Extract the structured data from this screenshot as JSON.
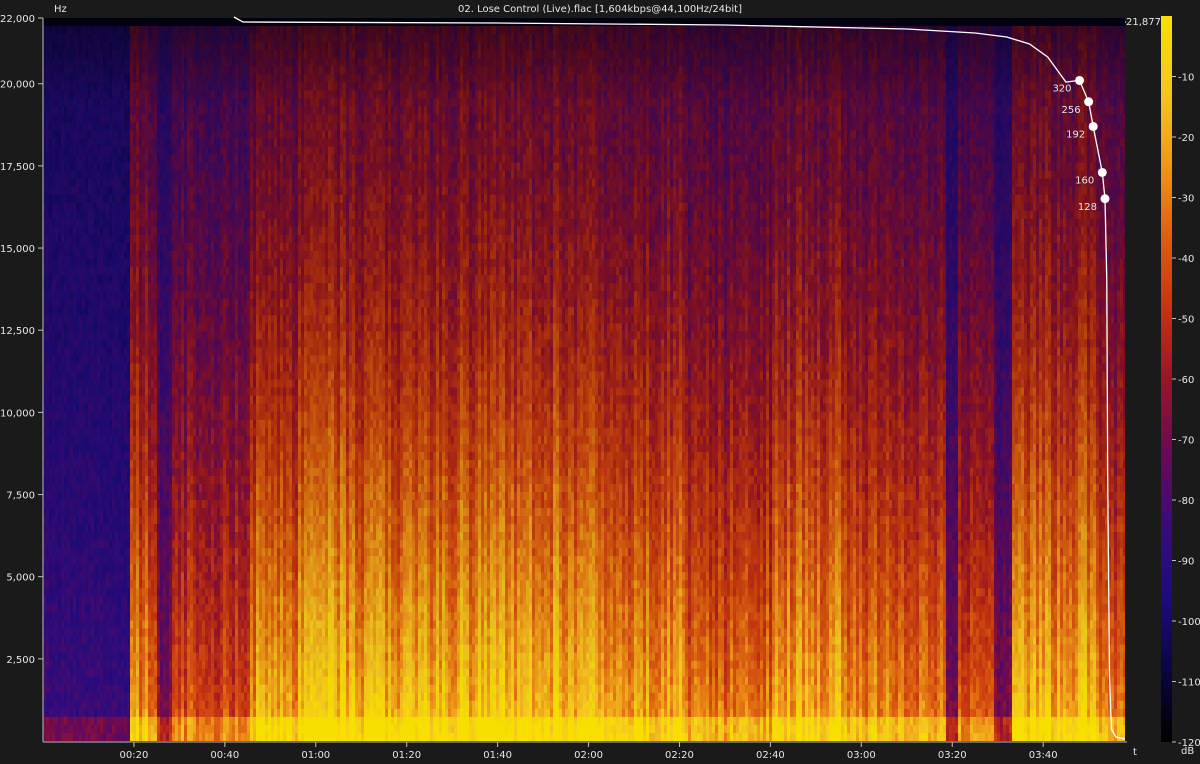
{
  "title": "02. Lose Control  (Live).flac [1,604kbps@44,100Hz/24bit]",
  "colors": {
    "background": "#1a1a1a",
    "plot_bg": "#0b0833",
    "text": "#e6e6e6",
    "cutoff_line": "#ffffff",
    "scale": [
      "#000000",
      "#0a0640",
      "#1d0b80",
      "#3a0b7a",
      "#6a0a55",
      "#9a1428",
      "#c83410",
      "#e06010",
      "#f09a18",
      "#f5c820",
      "#f8e000"
    ]
  },
  "chart_data": {
    "type": "heatmap",
    "title": "02. Lose Control  (Live).flac [1,604kbps@44,100Hz/24bit]",
    "ylabel": "Hz",
    "xlabel": "t",
    "colorbar_label": "dB",
    "ylim": [
      0,
      22000
    ],
    "xlim_seconds": [
      0,
      238
    ],
    "y_ticks": [
      {
        "value": 22000,
        "label": "22,000"
      },
      {
        "value": 20000,
        "label": "20,000"
      },
      {
        "value": 17500,
        "label": "17,500"
      },
      {
        "value": 15000,
        "label": "15,000"
      },
      {
        "value": 12500,
        "label": "12,500"
      },
      {
        "value": 10000,
        "label": "10,000"
      },
      {
        "value": 7500,
        "label": "7,500"
      },
      {
        "value": 5000,
        "label": "5,000"
      },
      {
        "value": 2500,
        "label": "2,500"
      }
    ],
    "x_ticks": [
      {
        "value": 20,
        "label": "00:20"
      },
      {
        "value": 40,
        "label": "00:40"
      },
      {
        "value": 60,
        "label": "01:00"
      },
      {
        "value": 80,
        "label": "01:20"
      },
      {
        "value": 100,
        "label": "01:40"
      },
      {
        "value": 120,
        "label": "02:00"
      },
      {
        "value": 140,
        "label": "02:20"
      },
      {
        "value": 160,
        "label": "02:40"
      },
      {
        "value": 180,
        "label": "03:00"
      },
      {
        "value": 200,
        "label": "03:20"
      },
      {
        "value": 220,
        "label": "03:40"
      }
    ],
    "colorbar_ticks": [
      {
        "value": -10,
        "label": "-10"
      },
      {
        "value": -20,
        "label": "-20"
      },
      {
        "value": -30,
        "label": "-30"
      },
      {
        "value": -40,
        "label": "-40"
      },
      {
        "value": -50,
        "label": "-50"
      },
      {
        "value": -60,
        "label": "-60"
      },
      {
        "value": -70,
        "label": "-70"
      },
      {
        "value": -80,
        "label": "-80"
      },
      {
        "value": -90,
        "label": "-90"
      },
      {
        "value": -100,
        "label": "-100"
      },
      {
        "value": -110,
        "label": "-110"
      },
      {
        "value": -120,
        "label": "-120"
      }
    ],
    "colorbar_range_db": [
      -120,
      0
    ],
    "cutoff_label": "21,877",
    "cutoff_hz": 21877,
    "bitrate_markers": [
      {
        "label": "320",
        "hz": 20100
      },
      {
        "label": "256",
        "hz": 19450
      },
      {
        "label": "192",
        "hz": 18700
      },
      {
        "label": "160",
        "hz": 17300
      },
      {
        "label": "128",
        "hz": 16500
      }
    ],
    "energy_segments": [
      {
        "t_start": 0,
        "t_end": 19,
        "level": 0.15
      },
      {
        "t_start": 19,
        "t_end": 25,
        "level": 0.75
      },
      {
        "t_start": 25,
        "t_end": 28,
        "level": 0.35
      },
      {
        "t_start": 28,
        "t_end": 45,
        "level": 0.6
      },
      {
        "t_start": 45,
        "t_end": 56,
        "level": 0.8
      },
      {
        "t_start": 56,
        "t_end": 125,
        "level": 0.88
      },
      {
        "t_start": 125,
        "t_end": 140,
        "level": 0.8
      },
      {
        "t_start": 140,
        "t_end": 160,
        "level": 0.68
      },
      {
        "t_start": 160,
        "t_end": 175,
        "level": 0.82
      },
      {
        "t_start": 175,
        "t_end": 198,
        "level": 0.72
      },
      {
        "t_start": 198,
        "t_end": 201,
        "level": 0.3
      },
      {
        "t_start": 201,
        "t_end": 209,
        "level": 0.58
      },
      {
        "t_start": 209,
        "t_end": 213,
        "level": 0.35
      },
      {
        "t_start": 213,
        "t_end": 232,
        "level": 0.85
      },
      {
        "t_start": 232,
        "t_end": 238,
        "level": 0.7
      }
    ]
  }
}
